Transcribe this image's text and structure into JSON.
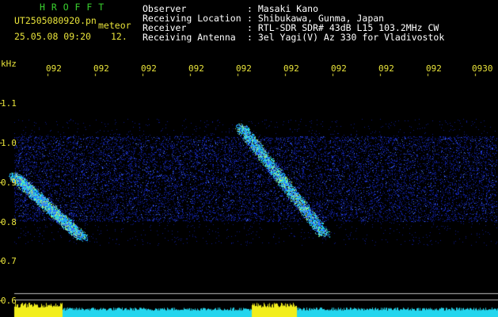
{
  "header": {
    "app_name": "H R O F F T",
    "filename": "UT2505080920.pn",
    "timestamp": "25.05.08 09:20",
    "event_label": "meteor",
    "number": "12.",
    "fields": [
      {
        "key": "Observer",
        "value": ": Masaki Kano"
      },
      {
        "key": "Receiving Location",
        "value": ": Shibukawa, Gunma, Japan"
      },
      {
        "key": "Receiver",
        "value": ": RTL-SDR SDR# 43dB L15 103.2MHz CW"
      },
      {
        "key": "Receiving Antenna",
        "value": ": 3el Yagi(V) Az 330 for Vladivostok"
      }
    ]
  },
  "axis": {
    "unit": "kHz",
    "y_ticks": [
      "1.1",
      "1.0",
      "0.9",
      "0.8",
      "0.7",
      "0.6"
    ],
    "x_ticks": [
      "092",
      "092",
      "092",
      "092",
      "092",
      "092",
      "092",
      "092",
      "092",
      "0930"
    ]
  },
  "colors": {
    "header_green": "#39d12e",
    "axis_yellow": "#e8e33a",
    "noise_blue": "#1a2fd6",
    "signal_cyan": "#18d8f0",
    "bar_yellow": "#f2ee1c",
    "bar_cyan": "#24d6ee"
  }
}
